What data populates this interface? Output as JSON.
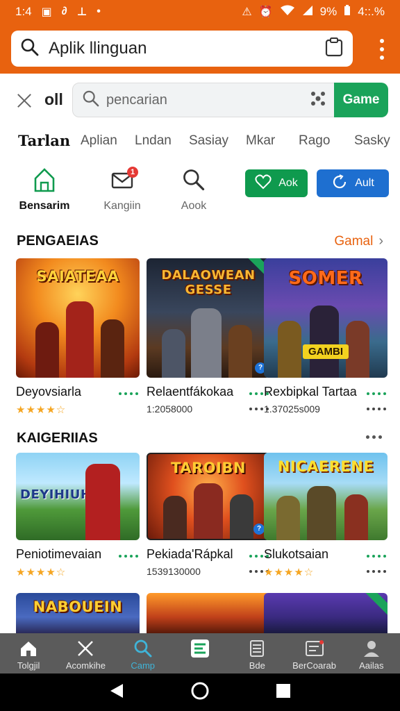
{
  "status_bar": {
    "time": "1:4",
    "battery": "9%",
    "clock_right": "4::.%"
  },
  "header": {
    "title": "Aplik llinguan"
  },
  "search": {
    "row_label": "oll",
    "placeholder": "pencarian",
    "button_label": "Game"
  },
  "tabs": [
    "Tarlan",
    "Aplian",
    "Lndan",
    "Sasiay",
    "Mkar",
    "Rago",
    "Sasky"
  ],
  "quick_actions": [
    {
      "label": "Bensarim",
      "icon": "store-icon",
      "active": true
    },
    {
      "label": "Kangiin",
      "icon": "mail-icon",
      "badge": "1"
    },
    {
      "label": "Aook",
      "icon": "search-icon"
    }
  ],
  "pills": [
    {
      "label": "Aok",
      "color": "#0f9a4e",
      "icon": "heart-icon"
    },
    {
      "label": "Ault",
      "color": "#1e6fd0",
      "icon": "refresh-icon"
    }
  ],
  "section1": {
    "title": "PENGAEIAS",
    "see_all": "Gamal",
    "cards": [
      {
        "art_title": "SAIATEAA",
        "name": "Deyovsiarla",
        "rating": 4
      },
      {
        "art_title": "DALAOWEAN GESSE",
        "name": "Relaentfákokaa",
        "count": "1:2058000"
      },
      {
        "art_title": "SOMER",
        "art_sub": "GAMBI",
        "name": "Rexbipkal Tartaa",
        "count": "1.37025s009"
      }
    ]
  },
  "section2": {
    "title": "KAIGERIIAS",
    "cards": [
      {
        "art_title": "DEYIHIUH",
        "name": "Peniotimevaian",
        "rating": 4
      },
      {
        "art_title": "TAROIBN",
        "name": "Pekiada'Rápkal",
        "count": "1539130000"
      },
      {
        "art_title": "NICAERENE",
        "name": "Slukotsaian",
        "rating": 4
      }
    ]
  },
  "section3": {
    "cards": [
      {
        "art_title": "NABOUEIN"
      },
      {
        "art_title": ""
      },
      {
        "art_title": ""
      }
    ]
  },
  "bottom_nav": [
    {
      "label": "Tolgjil",
      "icon": "home-icon"
    },
    {
      "label": "Acomkihe",
      "icon": "tools-icon"
    },
    {
      "label": "Camp",
      "icon": "search-icon",
      "active": true
    },
    {
      "label": "",
      "icon": "game-app-icon"
    },
    {
      "label": "Bde",
      "icon": "book-icon"
    },
    {
      "label": "BerCoarab",
      "icon": "inbox-icon"
    },
    {
      "label": "Aailas",
      "icon": "account-icon"
    }
  ],
  "colors": {
    "accent": "#e8620f",
    "green": "#1aa35a",
    "blue": "#1e6fd0",
    "star": "#f5a623"
  }
}
